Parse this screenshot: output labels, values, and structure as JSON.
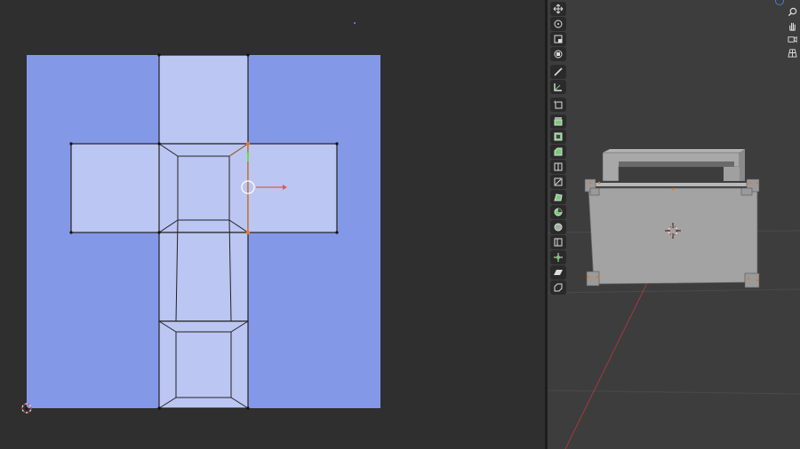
{
  "uv_editor": {
    "colors": {
      "background": "#2f2f2f",
      "texture_bounds": "#8398e6",
      "uv_face": "#bcc6f2",
      "edge": "#222222",
      "selected_edge": "#e07a2a",
      "x_axis": "#e05a5a",
      "y_axis": "#6ddc4c"
    },
    "gizmo": [
      "transform-gizmo-circle",
      "x-axis-arrow"
    ],
    "cursor": "2d-cursor"
  },
  "viewport": {
    "colors": {
      "background": "#3d3d3d",
      "mesh": "#a0a0a0",
      "x_axis_line": "#a33a3a"
    },
    "toolbar": [
      "move-icon",
      "rotate-icon",
      "scale-icon",
      "transform-icon",
      "annotate-icon",
      "measure-icon",
      "add-cube-icon",
      "extrude-region-icon",
      "inset-faces-icon",
      "bevel-icon",
      "loop-cut-icon",
      "knife-icon",
      "poly-build-icon",
      "spin-icon",
      "smooth-icon",
      "edge-slide-icon",
      "shrink-fatten-icon",
      "shear-icon",
      "rip-region-icon"
    ],
    "navigation": [
      "zoom-icon",
      "hand-icon",
      "camera-icon",
      "grid-icon"
    ]
  }
}
